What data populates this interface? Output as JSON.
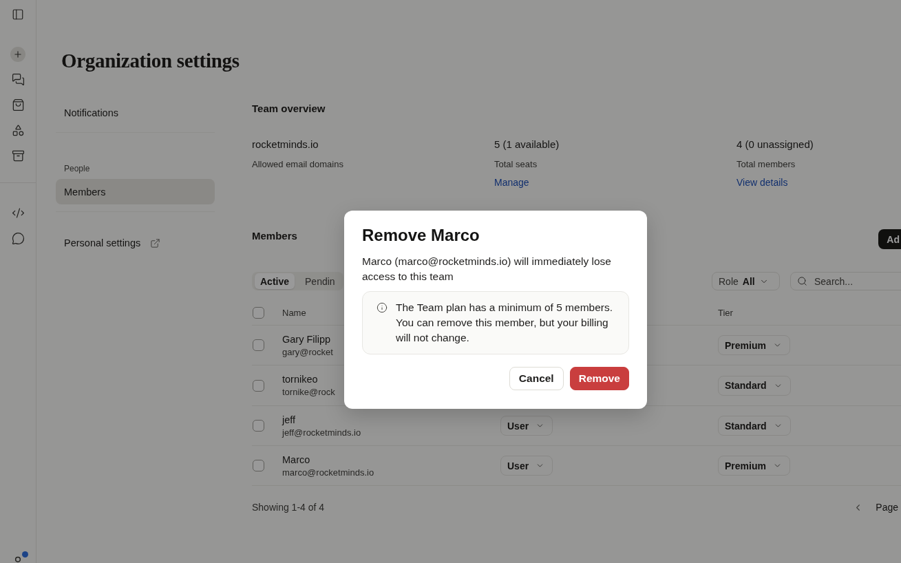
{
  "app_rail": {
    "account": {
      "unread": true
    }
  },
  "page": {
    "title": "Organization settings"
  },
  "settings_nav": {
    "sections": [
      {
        "items": [
          {
            "label": "Notifications",
            "selected": false,
            "external": false
          }
        ]
      },
      {
        "heading": "People",
        "items": [
          {
            "label": "Members",
            "selected": true,
            "external": false
          }
        ]
      },
      {
        "items": [
          {
            "label": "Personal settings",
            "selected": false,
            "external": true
          }
        ]
      }
    ]
  },
  "team_overview": {
    "title": "Team overview",
    "stats": [
      {
        "value": "rocketminds.io",
        "label": "Allowed email domains"
      },
      {
        "value": "5 (1 available)",
        "label": "Total seats",
        "link": "Manage"
      },
      {
        "value": "4 (0 unassigned)",
        "label": "Total members",
        "link": "View details"
      }
    ]
  },
  "members": {
    "title": "Members",
    "add_button": "Ad",
    "tabs": [
      {
        "label": "Active",
        "selected": true
      },
      {
        "label": "Pendin",
        "selected": false
      }
    ],
    "role_filter": {
      "label": "Role",
      "value": "All"
    },
    "search": {
      "placeholder": "Search..."
    },
    "table": {
      "all_checked": false,
      "columns": {
        "name": "Name",
        "tier": "Tier"
      },
      "rows": [
        {
          "name": "Gary Filipp",
          "email": "gary@rocket",
          "tier": "Premium",
          "checked": false
        },
        {
          "name": "tornikeo",
          "email": "tornike@rock",
          "tier": "Standard",
          "checked": false
        },
        {
          "name": "jeff",
          "email": "jeff@rocketminds.io",
          "role": "User",
          "tier": "Standard",
          "checked": false
        },
        {
          "name": "Marco",
          "email": "marco@rocketminds.io",
          "role": "User",
          "tier": "Premium",
          "checked": false
        }
      ]
    },
    "footer": "Showing 1-4 of 4",
    "pagination": {
      "label": "Page"
    }
  },
  "dialog": {
    "title": "Remove Marco",
    "message": "Marco (marco@rocketminds.io) will immediately lose access to this team",
    "notice": "The Team plan has a minimum of 5 members. You can remove this member, but your billing will not change.",
    "buttons": [
      {
        "label": "Cancel",
        "kind": "secondary"
      },
      {
        "label": "Remove",
        "kind": "danger"
      }
    ]
  }
}
